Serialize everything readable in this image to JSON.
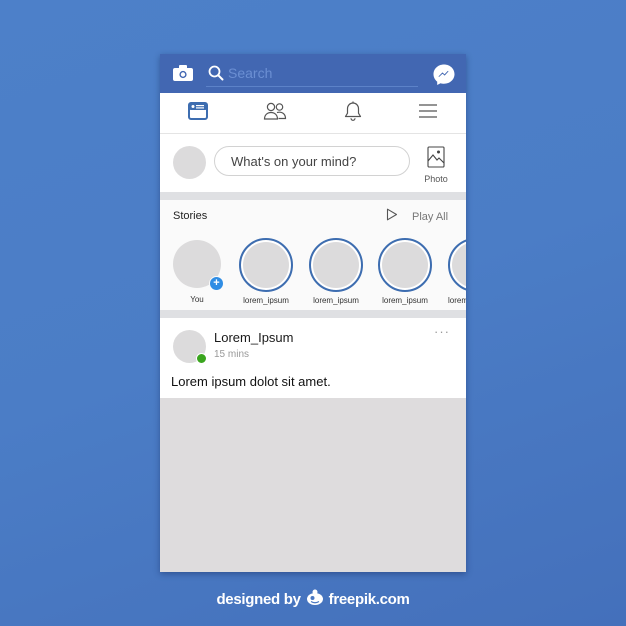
{
  "colors": {
    "brand": "#4267b2",
    "story_ring": "#3d6db0",
    "online": "#3aa51e",
    "add_badge": "#2f8de4",
    "background": "#4b7dc6"
  },
  "topbar": {
    "camera_icon": "camera-icon",
    "search": {
      "icon": "search-icon",
      "placeholder": "Search",
      "value": ""
    },
    "messenger_icon": "messenger-icon"
  },
  "navbar": {
    "items": [
      {
        "name": "news-feed",
        "icon": "news-feed-icon",
        "active": true
      },
      {
        "name": "friends",
        "icon": "friends-icon",
        "active": false
      },
      {
        "name": "notifications",
        "icon": "bell-icon",
        "active": false
      },
      {
        "name": "menu",
        "icon": "hamburger-menu-icon",
        "active": false
      }
    ]
  },
  "composer": {
    "placeholder": "What's on your mind?",
    "photo_label": "Photo"
  },
  "stories": {
    "title": "Stories",
    "play_all": "Play All",
    "items": [
      {
        "label": "You",
        "own": true
      },
      {
        "label": "lorem_ipsum",
        "own": false
      },
      {
        "label": "lorem_ipsum",
        "own": false
      },
      {
        "label": "lorem_ipsum",
        "own": false
      },
      {
        "label": "lorem_ipsum",
        "own": false
      }
    ]
  },
  "post": {
    "author": "Lorem_Ipsum",
    "time": "15 mins",
    "text": "Lorem ipsum dolot sit amet.",
    "online": true,
    "more": "···"
  },
  "credit": {
    "prefix": "designed by",
    "brand": "freepik.com"
  }
}
